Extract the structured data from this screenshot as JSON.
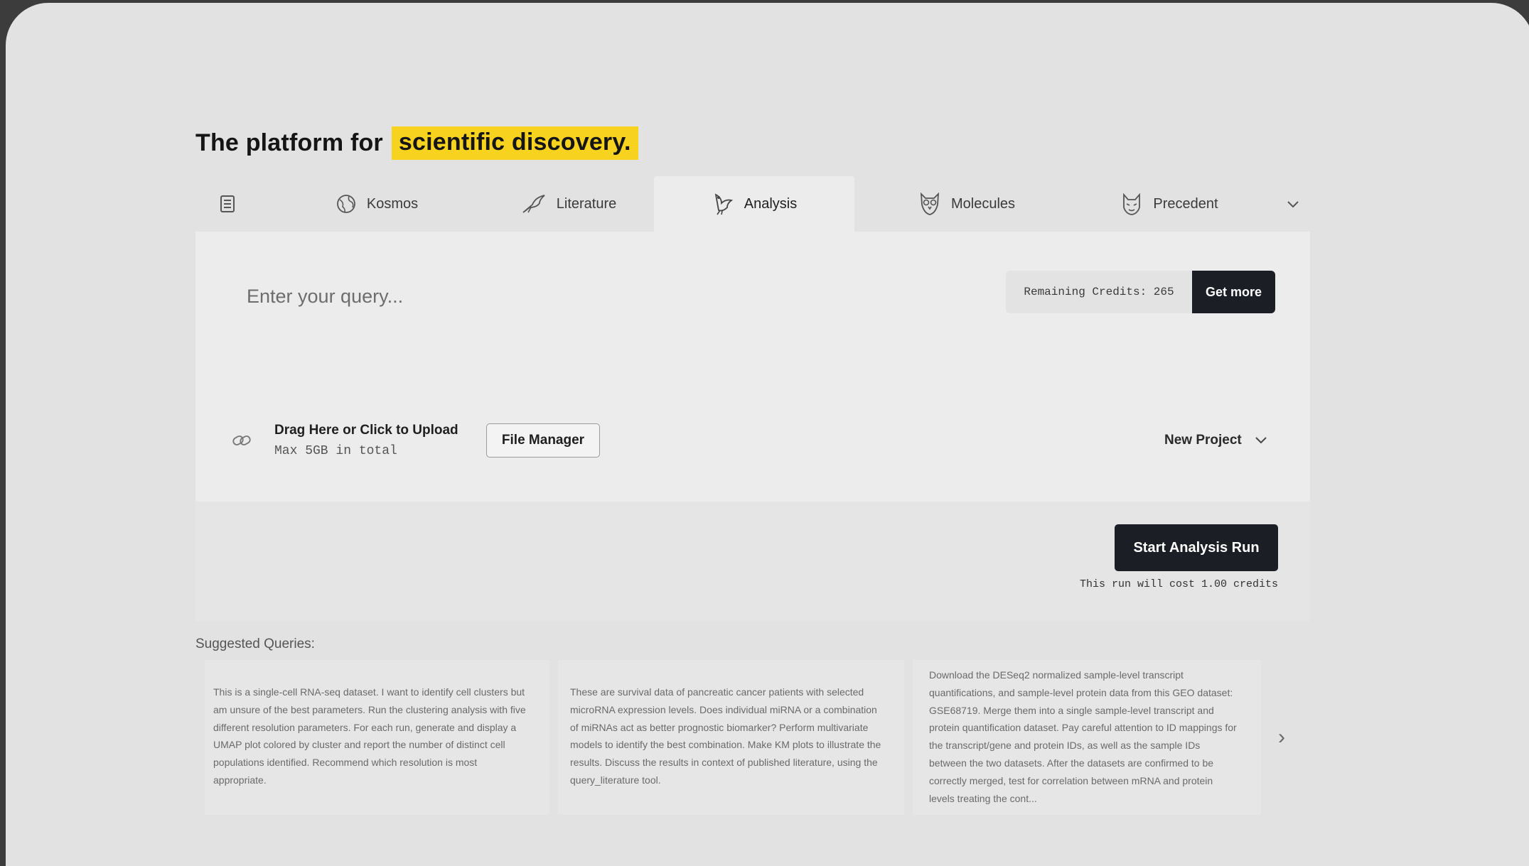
{
  "headline": {
    "prefix": "The platform for",
    "highlight": "scientific discovery."
  },
  "tabs": [
    {
      "label": "",
      "icon": "notebook-icon"
    },
    {
      "label": "Kosmos",
      "icon": "globe-icon"
    },
    {
      "label": "Literature",
      "icon": "bird-icon"
    },
    {
      "label": "Analysis",
      "icon": "bird-icon",
      "active": true
    },
    {
      "label": "Molecules",
      "icon": "owl-icon"
    },
    {
      "label": "Precedent",
      "icon": "animal-icon"
    }
  ],
  "query": {
    "placeholder": "Enter your query..."
  },
  "credits": {
    "text": "Remaining Credits: 265",
    "get_more_label": "Get more"
  },
  "upload": {
    "title": "Drag Here or Click to Upload",
    "subtitle": "Max 5GB in total",
    "file_manager_label": "File Manager"
  },
  "project": {
    "selected": "New Project"
  },
  "run": {
    "button_label": "Start Analysis Run",
    "cost_note": "This run will cost 1.00 credits"
  },
  "suggested": {
    "label": "Suggested Queries:",
    "items": [
      "This is a single-cell RNA-seq dataset. I want to identify cell clusters but am unsure of the best parameters. Run the clustering analysis with five different resolution parameters. For each run, generate and display a UMAP plot colored by cluster and report the number of distinct cell populations identified. Recommend which resolution is most appropriate.",
      "These are survival data of pancreatic cancer patients with selected microRNA expression levels. Does individual miRNA or a combination of miRNAs act as better prognostic biomarker? Perform multivariate models to identify the best combination. Make KM plots to illustrate the results. Discuss the results in context of published literature, using the query_literature tool.",
      "Download the DESeq2 normalized sample-level transcript quantifications, and sample-level protein data from this GEO dataset: GSE68719. Merge them into a single sample-level transcript and protein quantification dataset. Pay careful attention to ID mappings for the transcript/gene and protein IDs, as well as the sample IDs between the two datasets. After the datasets are confirmed to be correctly merged, test for correlation between mRNA and protein levels treating the cont..."
    ]
  },
  "colors": {
    "highlight": "#f7d21e",
    "dark_button": "#1b1e24",
    "background": "#e2e2e2"
  }
}
